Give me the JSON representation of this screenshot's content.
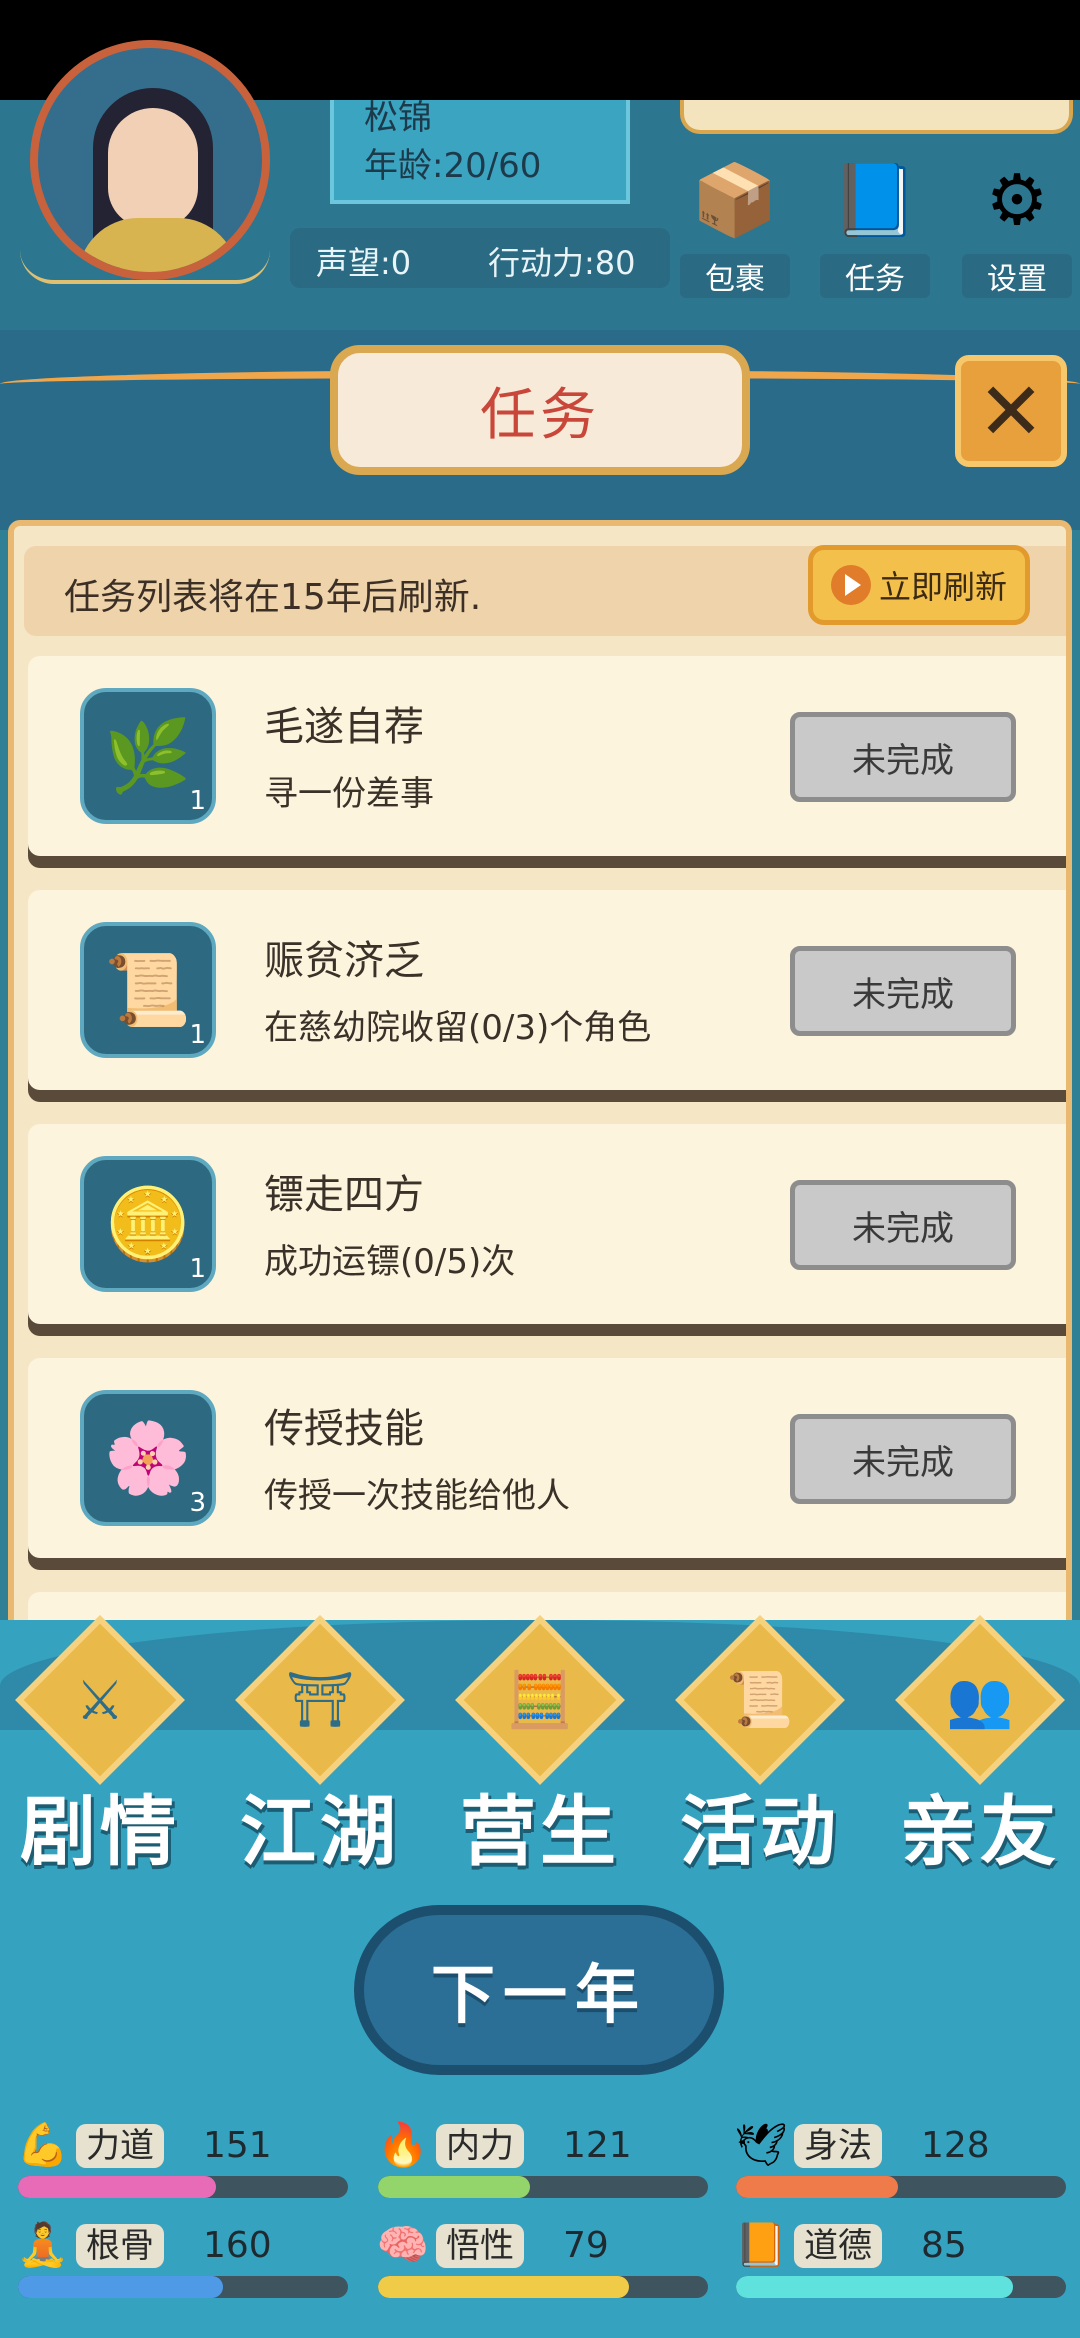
{
  "player": {
    "name": "松锦",
    "age": "年龄:20/60",
    "reputation": "声望:0",
    "action_points": "行动力:80"
  },
  "top_buttons": [
    {
      "label": "包裹",
      "icon": "package-icon"
    },
    {
      "label": "任务",
      "icon": "book-icon"
    },
    {
      "label": "设置",
      "icon": "gear-icon"
    }
  ],
  "modal": {
    "title": "任务",
    "refresh_notice": "任务列表将在15年后刷新.",
    "refresh_button": "立即刷新",
    "tasks": [
      {
        "title": "毛遂自荐",
        "desc": "寻一份差事",
        "count": "1",
        "status": "未完成",
        "icon": "wreath-icon"
      },
      {
        "title": "赈贫济乏",
        "desc": "在慈幼院收留(0/3)个角色",
        "count": "1",
        "status": "未完成",
        "icon": "token-icon"
      },
      {
        "title": "镖走四方",
        "desc": "成功运镖(0/5)次",
        "count": "1",
        "status": "未完成",
        "icon": "gold-ingot-icon"
      },
      {
        "title": "传授技能",
        "desc": "传授一次技能给他人",
        "count": "3",
        "status": "未完成",
        "icon": "flower-icon"
      }
    ]
  },
  "nav": [
    {
      "label": "剧情",
      "icon": "story-icon"
    },
    {
      "label": "江湖",
      "icon": "hat-icon"
    },
    {
      "label": "营生",
      "icon": "abacus-icon"
    },
    {
      "label": "活动",
      "icon": "scroll-icon"
    },
    {
      "label": "亲友",
      "icon": "friends-icon"
    }
  ],
  "next_year_button": "下一年",
  "stats": [
    {
      "name": "力道",
      "value": "151",
      "fill": 0.6,
      "color": "#e86bb8",
      "icon": "arm-icon"
    },
    {
      "name": "内力",
      "value": "121",
      "fill": 0.46,
      "color": "#93d56a",
      "icon": "flame-icon"
    },
    {
      "name": "身法",
      "value": "128",
      "fill": 0.49,
      "color": "#ef7b4b",
      "icon": "swallow-icon"
    },
    {
      "name": "根骨",
      "value": "160",
      "fill": 0.62,
      "color": "#4f9ae6",
      "icon": "figure-icon"
    },
    {
      "name": "悟性",
      "value": "79",
      "fill": 0.76,
      "color": "#f0cb47",
      "icon": "brain-icon"
    },
    {
      "name": "道德",
      "value": "85",
      "fill": 0.84,
      "color": "#5fe2de",
      "icon": "book-stat-icon"
    }
  ]
}
